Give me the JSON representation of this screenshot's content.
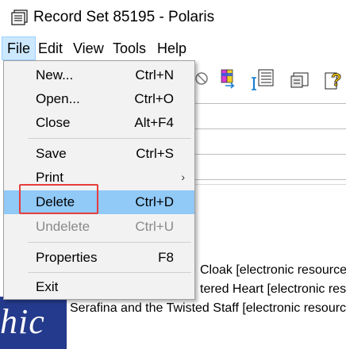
{
  "window": {
    "title": "Record Set 85195  -  Polaris"
  },
  "menubar": {
    "items": [
      {
        "label": "File"
      },
      {
        "label": "Edit"
      },
      {
        "label": "View"
      },
      {
        "label": "Tools"
      },
      {
        "label": "Help"
      }
    ]
  },
  "file_menu": {
    "items": [
      {
        "label": "New...",
        "accel": "Ctrl+N"
      },
      {
        "label": "Open...",
        "accel": "Ctrl+O"
      },
      {
        "label": "Close",
        "accel": "Alt+F4"
      },
      {
        "label": "Save",
        "accel": "Ctrl+S"
      },
      {
        "label": "Print",
        "accel": ""
      },
      {
        "label": "Delete",
        "accel": "Ctrl+D"
      },
      {
        "label": "Undelete",
        "accel": "Ctrl+U"
      },
      {
        "label": "Properties",
        "accel": "F8"
      },
      {
        "label": "Exit",
        "accel": ""
      }
    ]
  },
  "results": {
    "rows": [
      "Cloak [electronic resource]",
      "tered Heart [electronic reso",
      "Serafina and the Twisted Staff [electronic resourc"
    ]
  },
  "banner": {
    "text": "hic"
  },
  "colors": {
    "menu_highlight": "#91c9f7",
    "callout": "#e53d3d",
    "banner": "#243a8c"
  }
}
